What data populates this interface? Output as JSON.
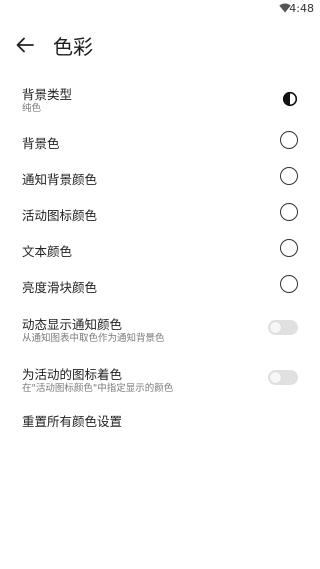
{
  "status_bar": {
    "time": "4:48",
    "wifi_icon": "wifi-icon"
  },
  "app_bar": {
    "title": "色彩",
    "back_icon": "arrow-left-icon"
  },
  "settings": {
    "background_type": {
      "label": "背景类型",
      "value": "纯色",
      "icon": "contrast-icon"
    },
    "background_color": {
      "label": "背景色"
    },
    "notification_background_color": {
      "label": "通知背景颜色"
    },
    "active_icon_color": {
      "label": "活动图标颜色"
    },
    "text_color": {
      "label": "文本颜色"
    },
    "brightness_slider_color": {
      "label": "亮度滑块颜色"
    },
    "dynamic_notification_color": {
      "label": "动态显示通知颜色",
      "description": "从通知图表中取色作为通知背景色",
      "enabled": false
    },
    "tint_active_icons": {
      "label": "为活动的图标着色",
      "description": "在\"活动图标颜色\"中指定显示的颜色",
      "enabled": false
    },
    "reset_colors": {
      "label": "重置所有颜色设置"
    }
  }
}
